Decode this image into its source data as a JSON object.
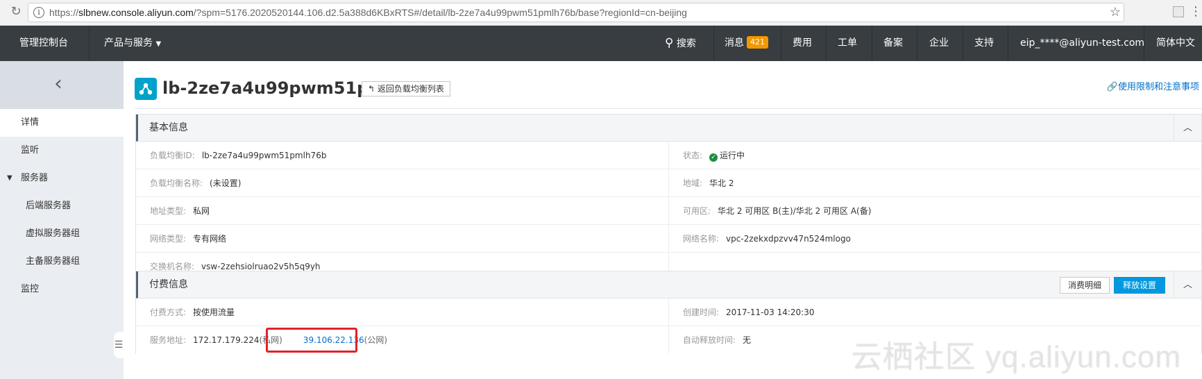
{
  "browser": {
    "url_prefix": "https://",
    "url_host": "slbnew.console.aliyun.com",
    "url_rest": "/?spm=5176.2020520144.106.d2.5a388d6KBxRTS#/detail/lb-2ze7a4u99pwm51pmlh76b/base?regionId=cn-beijing"
  },
  "topnav": {
    "console": "管理控制台",
    "products": "产品与服务",
    "search": "搜索",
    "messages": "消息",
    "messages_count": "421",
    "billing": "费用",
    "tickets": "工单",
    "icp": "备案",
    "enterprise": "企业",
    "support": "支持",
    "account": "eip_****@aliyun-test.com",
    "language": "简体中文"
  },
  "sidebar": {
    "items": [
      {
        "label": "详情"
      },
      {
        "label": "监听"
      },
      {
        "label": "服务器"
      },
      {
        "label": "后端服务器"
      },
      {
        "label": "虚拟服务器组"
      },
      {
        "label": "主备服务器组"
      },
      {
        "label": "监控"
      }
    ]
  },
  "header": {
    "title": "lb-2ze7a4u99pwm51p...",
    "back_button": "返回负载均衡列表",
    "usage_link": "使用限制和注意事项"
  },
  "basic_info": {
    "title": "基本信息",
    "lb_id_label": "负载均衡ID:",
    "lb_id": "lb-2ze7a4u99pwm51pmlh76b",
    "status_label": "状态:",
    "status": "运行中",
    "name_label": "负载均衡名称:",
    "name": "(未设置)",
    "region_label": "地域:",
    "region": "华北 2",
    "addr_type_label": "地址类型:",
    "addr_type": "私网",
    "zone_label": "可用区:",
    "zone": "华北 2 可用区 B(主)/华北 2 可用区 A(备)",
    "network_type_label": "网络类型:",
    "network_type": "专有网络",
    "network_name_label": "网络名称:",
    "network_name": "vpc-2zekxdpzvv47n524mlogo",
    "vswitch_label": "交换机名称:",
    "vswitch": "vsw-2zehsiolruao2v5h5q9yh"
  },
  "billing_info": {
    "title": "付费信息",
    "details_button": "消费明细",
    "release_button": "释放设置",
    "pay_method_label": "付费方式:",
    "pay_method": "按使用流量",
    "created_label": "创建时间:",
    "created": "2017-11-03 14:20:30",
    "service_addr_label": "服务地址:",
    "private_ip": "172.17.179.224",
    "private_tag": "(私网)",
    "public_ip": "39.106.22.136",
    "public_tag": "(公网)",
    "auto_release_label": "自动释放时间:",
    "auto_release": "无"
  },
  "watermark": "云栖社区 yq.aliyun.com"
}
